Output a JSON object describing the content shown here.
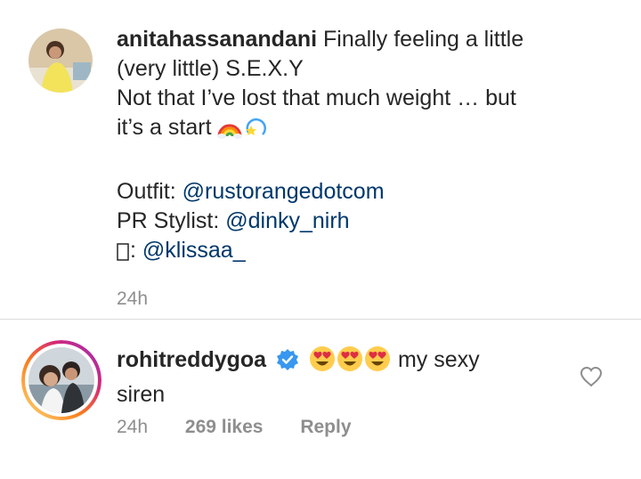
{
  "post": {
    "username": "anitahassanandani",
    "caption_line1": "Finally feeling a little",
    "caption_line2": "(very little) S.E.X.Y",
    "caption_line3": "Not that I’ve lost that much weight … but",
    "caption_line4": "it’s a start",
    "caption_emojis": [
      "rainbow-icon",
      "dizzy-star-icon"
    ],
    "outfit_label": "Outfit: ",
    "outfit_mention": "@rustorangedotcom",
    "pr_label": "PR Stylist: ",
    "pr_mention": "@dinky_nirh",
    "camera_label": ": ",
    "camera_mention": "@klissaa_",
    "time": "24h"
  },
  "comment": {
    "username": "rohitreddygoa",
    "verified": true,
    "emojis": [
      "heart-eyes-icon",
      "heart-eyes-icon",
      "heart-eyes-icon"
    ],
    "text_part1": "my sexy",
    "text_part2": "siren",
    "time": "24h",
    "likes": "269 likes",
    "reply_label": "Reply"
  },
  "colors": {
    "text": "#262626",
    "mention": "#00376b",
    "meta": "#8e8e8e",
    "verified": "#3897f0",
    "divider": "#dbdbdb"
  }
}
